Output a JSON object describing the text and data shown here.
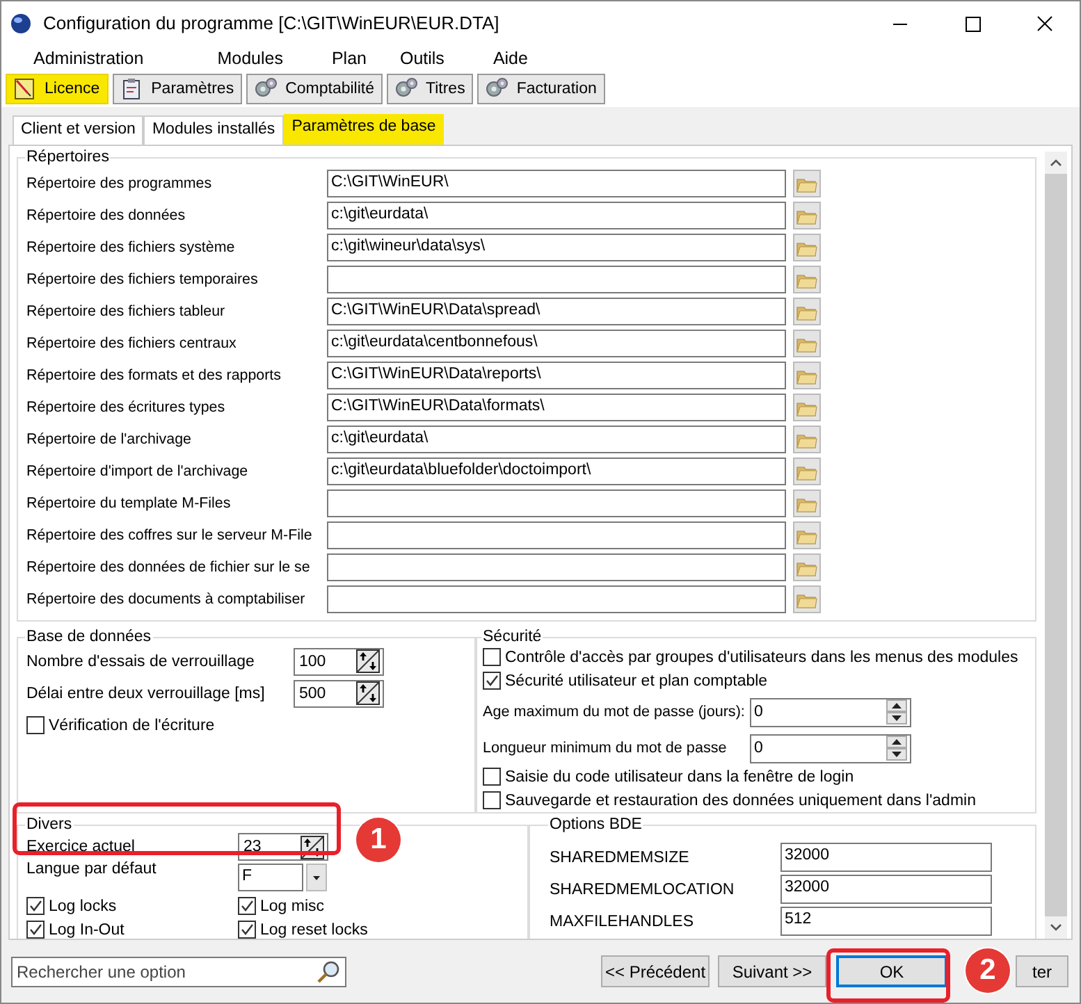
{
  "window": {
    "title": "Configuration du programme [C:\\GIT\\WinEUR\\EUR.DTA]"
  },
  "menu": [
    "Administration",
    "Modules",
    "Plan",
    "Outils",
    "Aide"
  ],
  "toolbar": [
    {
      "label": "Licence",
      "selected": true
    },
    {
      "label": "Paramètres",
      "selected": false
    },
    {
      "label": "Comptabilité",
      "selected": false
    },
    {
      "label": "Titres",
      "selected": false
    },
    {
      "label": "Facturation",
      "selected": false
    }
  ],
  "tabs": [
    {
      "label": "Client et version",
      "selected": false
    },
    {
      "label": "Modules installés",
      "selected": false
    },
    {
      "label": "Paramètres de base",
      "selected": true
    }
  ],
  "directories": {
    "title": "Répertoires",
    "rows": [
      {
        "label": "Répertoire des programmes",
        "value": "C:\\GIT\\WinEUR\\"
      },
      {
        "label": "Répertoire des données",
        "value": "c:\\git\\eurdata\\"
      },
      {
        "label": "Répertoire des fichiers système",
        "value": "c:\\git\\wineur\\data\\sys\\"
      },
      {
        "label": "Répertoire des fichiers temporaires"
      },
      {
        "label": "Répertoire des fichiers tableur",
        "value": "C:\\GIT\\WinEUR\\Data\\spread\\"
      },
      {
        "label": "Répertoire des fichiers centraux",
        "value": "c:\\git\\eurdata\\centbonnefous\\"
      },
      {
        "label": "Répertoire des formats et des rapports",
        "value": "C:\\GIT\\WinEUR\\Data\\reports\\"
      },
      {
        "label": "Répertoire des écritures types",
        "value": "C:\\GIT\\WinEUR\\Data\\formats\\"
      },
      {
        "label": "Répertoire de l'archivage",
        "value": "c:\\git\\eurdata\\"
      },
      {
        "label": "Répertoire d'import de l'archivage",
        "value": "c:\\git\\eurdata\\bluefolder\\doctoimport\\"
      },
      {
        "label": "Répertoire du template M-Files"
      },
      {
        "label": "Répertoire des coffres sur le serveur M-File"
      },
      {
        "label": "Répertoire des données de fichier sur le se"
      },
      {
        "label": "Répertoire des documents à comptabiliser"
      }
    ]
  },
  "database": {
    "title": "Base de données",
    "fields": [
      {
        "label": "Nombre d'essais de verrouillage",
        "value": "100"
      },
      {
        "label": "Délai entre deux verrouillage [ms]",
        "value": "500"
      }
    ],
    "checkboxes": [
      {
        "label": "Vérification de l'écriture",
        "checked": false
      }
    ]
  },
  "security": {
    "title": "Sécurité",
    "items": [
      {
        "kind": "checkbox",
        "label": "Contrôle d'accès par groupes d'utilisateurs dans les menus des modules",
        "checked": false
      },
      {
        "kind": "checkbox",
        "label": "Sécurité utilisateur et plan comptable",
        "checked": true
      },
      {
        "kind": "spin",
        "label": "Age maximum du mot de passe (jours):",
        "value": "0"
      },
      {
        "kind": "spin",
        "label": "Longueur minimum du mot de passe",
        "value": "0"
      },
      {
        "kind": "checkbox",
        "label": "Saisie du code utilisateur dans la fenêtre de login",
        "checked": false
      },
      {
        "kind": "checkbox",
        "label": "Sauvegarde et restauration des données uniquement dans l'admin",
        "checked": false
      }
    ]
  },
  "divers": {
    "title": "Divers",
    "fields": [
      {
        "kind": "spin",
        "label": "Exercice actuel",
        "value": "23"
      },
      {
        "kind": "dropdown",
        "label": "Langue par défaut",
        "value": "F"
      }
    ],
    "checkboxes": [
      {
        "label": "Log locks",
        "checked": true
      },
      {
        "label": "Log misc",
        "checked": true
      },
      {
        "label": "Log In-Out",
        "checked": true
      },
      {
        "label": "Log reset locks",
        "checked": true
      }
    ]
  },
  "bde": {
    "title": "Options BDE",
    "rows": [
      {
        "label": "SHAREDMEMSIZE",
        "value": "32000"
      },
      {
        "label": "SHAREDMEMLOCATION",
        "value": "32000"
      },
      {
        "label": "MAXFILEHANDLES",
        "value": "512"
      }
    ]
  },
  "search": {
    "placeholder": "Rechercher une option"
  },
  "buttons": [
    {
      "label": "<< Précédent",
      "focused": false
    },
    {
      "label": "Suivant  >>",
      "focused": false
    },
    {
      "label": "OK",
      "focused": true
    },
    {
      "label": "ter",
      "focused": false
    }
  ],
  "annotations": [
    {
      "label": "1"
    },
    {
      "label": "2"
    }
  ]
}
